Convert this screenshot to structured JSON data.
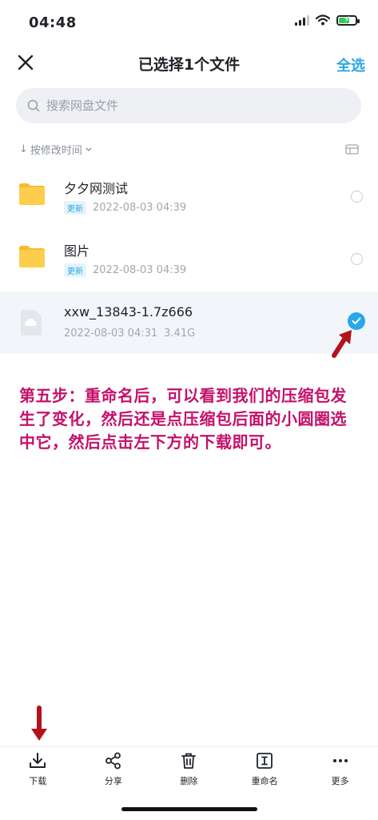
{
  "status_bar": {
    "time": "04:48"
  },
  "header": {
    "title": "已选择1个文件",
    "select_all": "全选"
  },
  "search": {
    "placeholder": "搜索网盘文件"
  },
  "sort": {
    "label": "按修改时间"
  },
  "files": [
    {
      "name": "夕夕网测试",
      "badge": "更新",
      "date": "2022-08-03 04:39",
      "size": "",
      "type": "folder",
      "selected": false
    },
    {
      "name": "图片",
      "badge": "更新",
      "date": "2022-08-03 04:39",
      "size": "",
      "type": "folder",
      "selected": false
    },
    {
      "name": "xxw_13843-1.7z666",
      "badge": "",
      "date": "2022-08-03 04:31",
      "size": "3.41G",
      "type": "file",
      "selected": true
    }
  ],
  "annotation": {
    "text": "第五步：重命名后，可以看到我们的压缩包发生了变化，然后还是点压缩包后面的小圆圈选中它，然后点击左下方的下载即可。"
  },
  "toolbar": {
    "download": "下载",
    "share": "分享",
    "delete": "删除",
    "rename": "重命名",
    "more": "更多"
  },
  "colors": {
    "accent": "#2aa7e8",
    "annotation": "#c4116a",
    "arrow": "#b3121c",
    "folder": "#fdc94a"
  }
}
